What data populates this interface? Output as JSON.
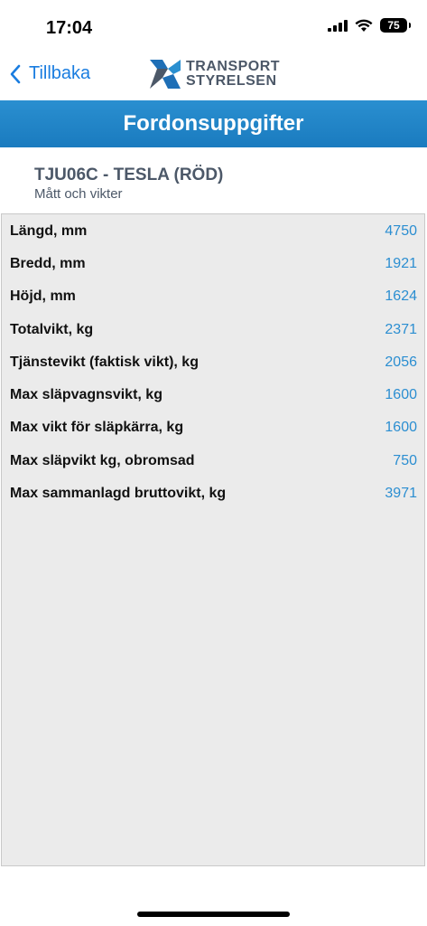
{
  "status": {
    "time": "17:04",
    "battery": "75"
  },
  "nav": {
    "back_label": "Tillbaka",
    "logo_line1": "TRANSPORT",
    "logo_line2": "STYRELSEN"
  },
  "page": {
    "title": "Fordonsuppgifter"
  },
  "vehicle": {
    "title": "TJU06C - TESLA (RÖD)",
    "subtitle": "Mått och vikter"
  },
  "rows": [
    {
      "label": "Längd, mm",
      "value": "4750"
    },
    {
      "label": "Bredd, mm",
      "value": "1921"
    },
    {
      "label": "Höjd, mm",
      "value": "1624"
    },
    {
      "label": "Totalvikt, kg",
      "value": "2371"
    },
    {
      "label": "Tjänstevikt (faktisk vikt), kg",
      "value": "2056"
    },
    {
      "label": "Max släpvagnsvikt, kg",
      "value": "1600"
    },
    {
      "label": "Max vikt för släpkärra, kg",
      "value": "1600"
    },
    {
      "label": "Max släpvikt kg, obromsad",
      "value": "750"
    },
    {
      "label": "Max sammanlagd bruttovikt, kg",
      "value": "3971"
    }
  ],
  "colors": {
    "accent": "#1a7de0",
    "header_bar": "#1f85c8",
    "value_text": "#2b8ed1",
    "title_text": "#4c5868"
  }
}
